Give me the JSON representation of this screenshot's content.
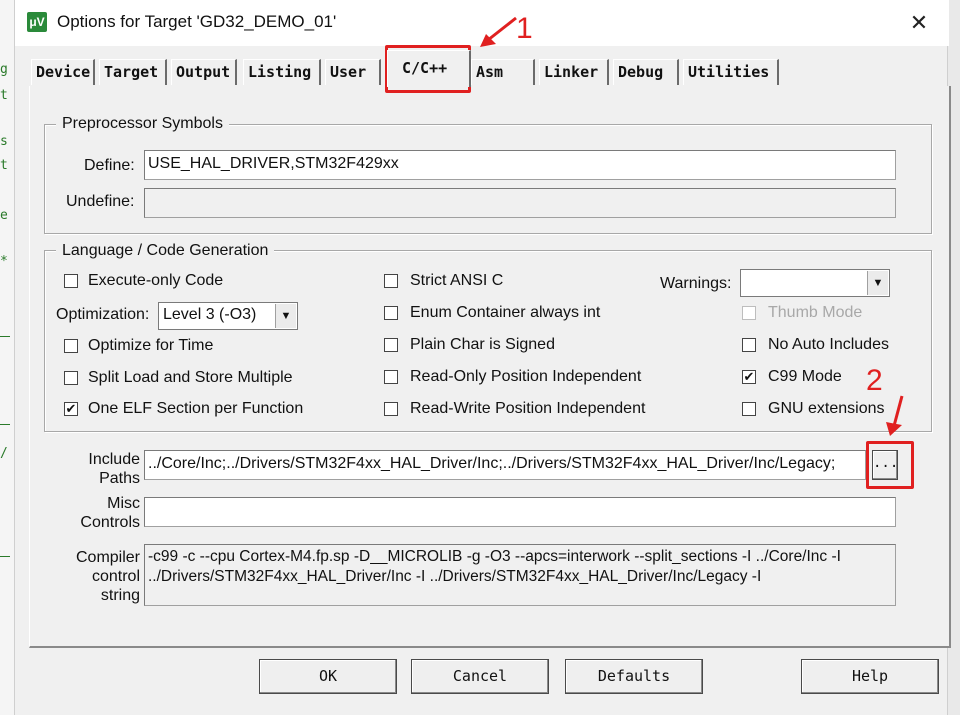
{
  "window": {
    "title": "Options for Target 'GD32_DEMO_01'",
    "close_glyph": "✕",
    "icon_glyph": "μV"
  },
  "tabs": [
    {
      "label": "Device"
    },
    {
      "label": "Target"
    },
    {
      "label": "Output"
    },
    {
      "label": "Listing"
    },
    {
      "label": "User"
    },
    {
      "label": "C/C++",
      "active": true
    },
    {
      "label": "Asm"
    },
    {
      "label": "Linker"
    },
    {
      "label": "Debug"
    },
    {
      "label": "Utilities"
    }
  ],
  "preprocessor": {
    "legend": "Preprocessor Symbols",
    "define_label": "Define:",
    "define_value": "USE_HAL_DRIVER,STM32F429xx",
    "undefine_label": "Undefine:",
    "undefine_value": ""
  },
  "language": {
    "legend": "Language / Code Generation",
    "execute_only": {
      "label": "Execute-only Code",
      "checked": false
    },
    "optimization_label": "Optimization:",
    "optimization_value": "Level 3 (-O3)",
    "optimize_time": {
      "label": "Optimize for Time",
      "checked": false
    },
    "split_load": {
      "label": "Split Load and Store Multiple",
      "checked": false
    },
    "one_elf": {
      "label": "One ELF Section per Function",
      "checked": true
    },
    "strict_ansi": {
      "label": "Strict ANSI C",
      "checked": false
    },
    "enum_int": {
      "label": "Enum Container always int",
      "checked": false
    },
    "plain_char": {
      "label": "Plain Char is Signed",
      "checked": false
    },
    "ro_pos": {
      "label": "Read-Only Position Independent",
      "checked": false
    },
    "rw_pos": {
      "label": "Read-Write Position Independent",
      "checked": false
    },
    "warnings_label": "Warnings:",
    "warnings_value": "",
    "thumb_mode": {
      "label": "Thumb Mode",
      "checked": false
    },
    "no_auto_includes": {
      "label": "No Auto Includes",
      "checked": false
    },
    "c99_mode": {
      "label": "C99 Mode",
      "checked": true
    },
    "gnu_ext": {
      "label": "GNU extensions",
      "checked": false
    }
  },
  "include": {
    "label_line1": "Include",
    "label_line2": "Paths",
    "value": "../Core/Inc;../Drivers/STM32F4xx_HAL_Driver/Inc;../Drivers/STM32F4xx_HAL_Driver/Inc/Legacy;",
    "browse_label": "..."
  },
  "misc": {
    "label_line1": "Misc",
    "label_line2": "Controls",
    "value": ""
  },
  "compiler": {
    "label_line1": "Compiler",
    "label_line2": "control",
    "label_line3": "string",
    "line1": "-c99 -c --cpu Cortex-M4.fp.sp -D__MICROLIB -g -O3 --apcs=interwork --split_sections -I ../Core/Inc -I",
    "line2": "../Drivers/STM32F4xx_HAL_Driver/Inc -I ../Drivers/STM32F4xx_HAL_Driver/Inc/Legacy -I"
  },
  "buttons": {
    "ok": "OK",
    "cancel": "Cancel",
    "defaults": "Defaults",
    "help": "Help"
  },
  "annotations": {
    "one": "1",
    "two": "2",
    "color": "#e02020"
  },
  "check_glyph": "✔"
}
